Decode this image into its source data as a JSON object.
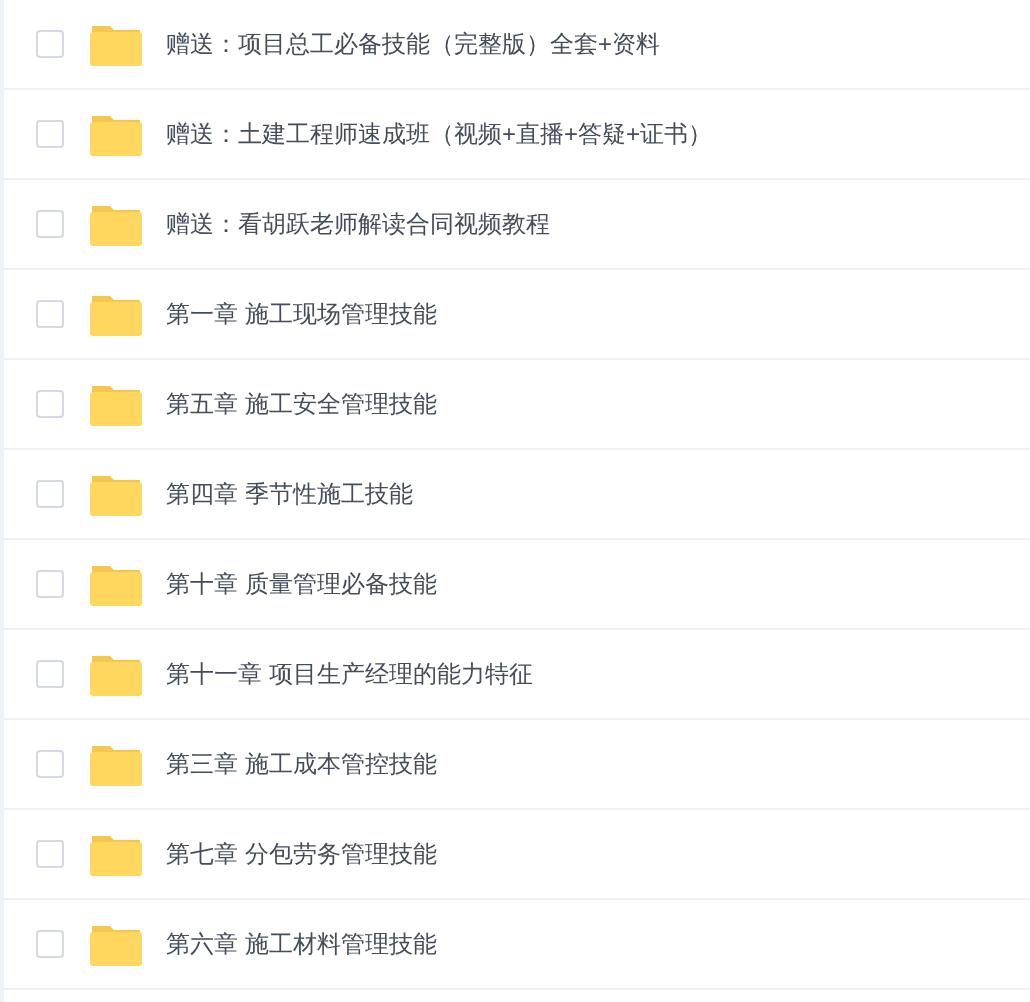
{
  "files": [
    {
      "name": "赠送：项目总工必备技能（完整版）全套+资料",
      "checked": false
    },
    {
      "name": "赠送：土建工程师速成班（视频+直播+答疑+证书）",
      "checked": false
    },
    {
      "name": "赠送：看胡跃老师解读合同视频教程",
      "checked": false
    },
    {
      "name": "第一章 施工现场管理技能",
      "checked": false
    },
    {
      "name": "第五章 施工安全管理技能",
      "checked": false
    },
    {
      "name": "第四章 季节性施工技能",
      "checked": false
    },
    {
      "name": "第十章 质量管理必备技能",
      "checked": false
    },
    {
      "name": "第十一章 项目生产经理的能力特征",
      "checked": false
    },
    {
      "name": "第三章 施工成本管控技能",
      "checked": false
    },
    {
      "name": "第七章 分包劳务管理技能",
      "checked": false
    },
    {
      "name": "第六章 施工材料管理技能",
      "checked": false
    }
  ]
}
